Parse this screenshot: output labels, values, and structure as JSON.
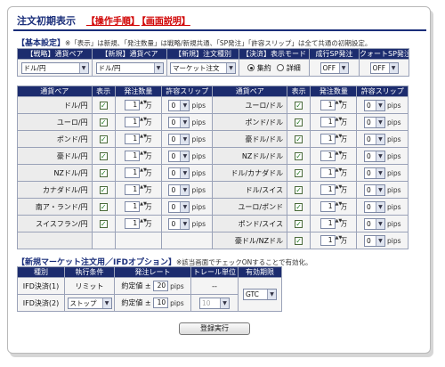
{
  "header": {
    "title": "注文初期表示",
    "link_procedure": "【操作手順】",
    "link_screen": "【画面説明】"
  },
  "basic": {
    "section_label": "【基本設定】",
    "note": "※「表示」は新規、「発注数量」は戦略/新規共通、「SP発注」「許容スリップ」は全て共通の初期設定。",
    "headers": [
      "【戦略】通貨ペア",
      "【新規】通貨ペア",
      "【新規】注文種別",
      "【決済】表示モード",
      "成行SP発注",
      "クォートSP発注"
    ],
    "strategy_pair": "ドル/円",
    "new_pair": "ドル/円",
    "order_type": "マーケット注文",
    "mode_summary": "集約",
    "mode_detail": "詳細",
    "market_sp": "OFF",
    "quote_sp": "OFF"
  },
  "pairs": {
    "headers": [
      "通貨ペア",
      "表示",
      "発注数量",
      "許容スリップ",
      "通貨ペア",
      "表示",
      "発注数量",
      "許容スリップ"
    ],
    "unit_label": "万",
    "pips_label": "pips",
    "check_glyph": "✓",
    "spin_glyph": "▲▼",
    "left": [
      {
        "name": "ドル/円",
        "qty": "1",
        "slip": "0"
      },
      {
        "name": "ユーロ/円",
        "qty": "1",
        "slip": "0"
      },
      {
        "name": "ポンド/円",
        "qty": "1",
        "slip": "0"
      },
      {
        "name": "豪ドル/円",
        "qty": "1",
        "slip": "0"
      },
      {
        "name": "NZドル/円",
        "qty": "1",
        "slip": "0"
      },
      {
        "name": "カナダドル/円",
        "qty": "1",
        "slip": "0"
      },
      {
        "name": "南ア・ランド/円",
        "qty": "1",
        "slip": "0"
      },
      {
        "name": "スイスフラン/円",
        "qty": "1",
        "slip": "0"
      }
    ],
    "right": [
      {
        "name": "ユーロ/ドル",
        "qty": "1",
        "slip": "0"
      },
      {
        "name": "ポンド/ドル",
        "qty": "1",
        "slip": "0"
      },
      {
        "name": "豪ドル/ドル",
        "qty": "1",
        "slip": "0"
      },
      {
        "name": "NZドル/ドル",
        "qty": "1",
        "slip": "0"
      },
      {
        "name": "ドル/カナダドル",
        "qty": "1",
        "slip": "0"
      },
      {
        "name": "ドル/スイス",
        "qty": "1",
        "slip": "0"
      },
      {
        "name": "ユーロ/ポンド",
        "qty": "1",
        "slip": "0"
      },
      {
        "name": "ポンド/スイス",
        "qty": "1",
        "slip": "0"
      },
      {
        "name": "豪ドル/NZドル",
        "qty": "1",
        "slip": "0"
      }
    ]
  },
  "ifd": {
    "section_label": "【新規マーケット注文用／IFDオプション】",
    "note": "※該当画面でチェックONすることで有効化。",
    "headers": [
      "種別",
      "執行条件",
      "発注レート",
      "トレール単位",
      "有効期限"
    ],
    "rows": [
      {
        "type": "IFD決済(1)",
        "cond": "リミット",
        "rate_label": "約定値 ±",
        "rate": "20",
        "pips": "pips",
        "trail": "--"
      },
      {
        "type": "IFD決済(2)",
        "cond": "ストップ",
        "rate_label": "約定値 ±",
        "rate": "10",
        "pips": "pips",
        "trail": "10"
      }
    ],
    "expiry": "GTC"
  },
  "submit_label": "登録実行",
  "colors": {
    "header_bg": "#1c2c6e",
    "accent": "#d00000",
    "title": "#1a2e7a"
  }
}
